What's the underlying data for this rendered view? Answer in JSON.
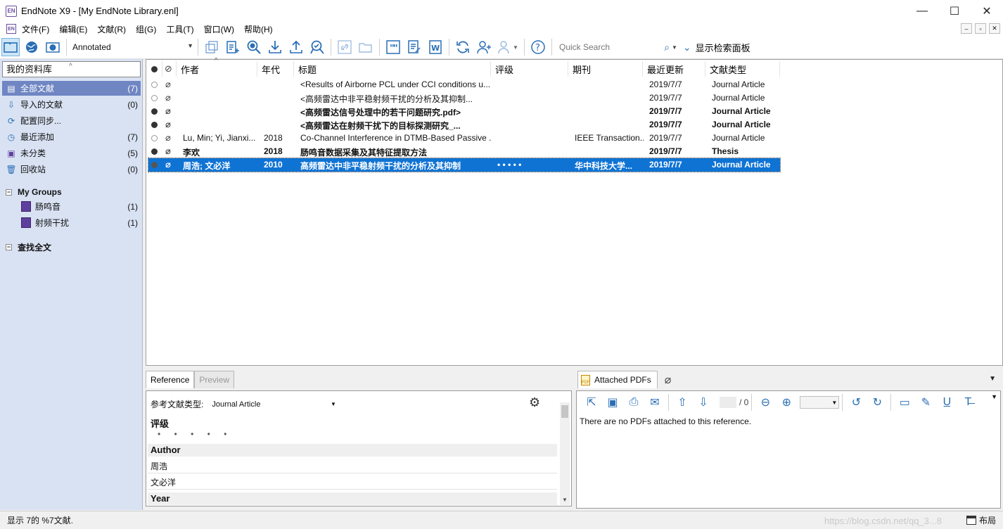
{
  "window": {
    "title": "EndNote X9 - [My EndNote Library.enl]",
    "logo_text": "EN",
    "minimize": "—",
    "maximize": "☐",
    "close": "✕"
  },
  "menu": [
    "文件(F)",
    "编辑(E)",
    "文献(R)",
    "组(G)",
    "工具(T)",
    "窗口(W)",
    "帮助(H)"
  ],
  "toolbar": {
    "style": "Annotated",
    "quick_search_placeholder": "Quick Search",
    "show_panel_label": "显示检索面板"
  },
  "left_panel": {
    "library_header": "我的资料库",
    "groups": [
      {
        "label": "全部文献",
        "count": "(7)",
        "icon": "all-references-icon"
      },
      {
        "label": "导入的文献",
        "count": "(0)",
        "icon": "imported-icon"
      },
      {
        "label": "配置同步...",
        "count": "",
        "icon": "sync-icon"
      },
      {
        "label": "最近添加",
        "count": "(7)",
        "icon": "recent-icon"
      },
      {
        "label": "未分类",
        "count": "(5)",
        "icon": "unfiled-icon"
      },
      {
        "label": "回收站",
        "count": "(0)",
        "icon": "trash-icon"
      }
    ],
    "my_groups_label": "My Groups",
    "my_groups": [
      {
        "label": "肠鸣音",
        "count": "(1)"
      },
      {
        "label": "射频干扰",
        "count": "(1)"
      }
    ],
    "find_fulltext_label": "查找全文"
  },
  "columns": [
    "作者",
    "年代",
    "标题",
    "评级",
    "期刊",
    "最近更新",
    "文献类型"
  ],
  "references": [
    {
      "read": true,
      "bold": false,
      "author": "",
      "year": "",
      "title": "<Results of Airborne PCL under CCI conditions u...",
      "rating": "",
      "journal": "",
      "updated": "2019/7/7",
      "type": "Journal Article"
    },
    {
      "read": true,
      "bold": false,
      "author": "",
      "year": "",
      "title": "<高频雷达中非平稳射频干扰的分析及其抑制...",
      "rating": "",
      "journal": "",
      "updated": "2019/7/7",
      "type": "Journal Article"
    },
    {
      "read": false,
      "bold": true,
      "author": "",
      "year": "",
      "title": "<高频雷达信号处理中的若干问题研究.pdf>",
      "rating": "",
      "journal": "",
      "updated": "2019/7/7",
      "type": "Journal Article"
    },
    {
      "read": false,
      "bold": true,
      "author": "",
      "year": "",
      "title": "<高频雷达在射频干扰下的目标探测研究_...",
      "rating": "",
      "journal": "",
      "updated": "2019/7/7",
      "type": "Journal Article"
    },
    {
      "read": true,
      "bold": false,
      "author": "Lu, Min; Yi, Jianxi...",
      "year": "2018",
      "title": "Co-Channel Interference in DTMB-Based Passive ...",
      "rating": "",
      "journal": "IEEE Transaction...",
      "updated": "2019/7/7",
      "type": "Journal Article"
    },
    {
      "read": false,
      "bold": true,
      "author": "李欢",
      "year": "2018",
      "title": "肠鸣音数据采集及其特征提取方法",
      "rating": "",
      "journal": "",
      "updated": "2019/7/7",
      "type": "Thesis"
    },
    {
      "read": false,
      "bold": true,
      "selected": true,
      "author": "周浩; 文必洋",
      "year": "2010",
      "title": "高频雷达中非平稳射频干扰的分析及其抑制",
      "rating": "• • • • •",
      "journal": "华中科技大学...",
      "updated": "2019/7/7",
      "type": "Journal Article"
    }
  ],
  "ref_panel": {
    "tab_reference": "Reference",
    "tab_preview": "Preview",
    "ref_type_label": "参考文献类型:",
    "ref_type_value": "Journal Article",
    "rating_label": "评级",
    "rating_dots": "• • • • •",
    "author_label": "Author",
    "authors": [
      "周浩",
      "文必洋"
    ],
    "year_label": "Year"
  },
  "pdf_panel": {
    "tab_label": "Attached PDFs",
    "page_total": "/ 0",
    "message": "There are no PDFs attached to this reference."
  },
  "status": {
    "text": "显示 7的 %7文献.",
    "layout_label": "布局",
    "watermark": "https://blog.csdn.net/qq_3...8"
  },
  "colors": {
    "selection": "#0f73d4",
    "left_panel_bg": "#d9e2f3",
    "selected_group": "#6f86c3",
    "icon_blue": "#2a6fb5"
  }
}
